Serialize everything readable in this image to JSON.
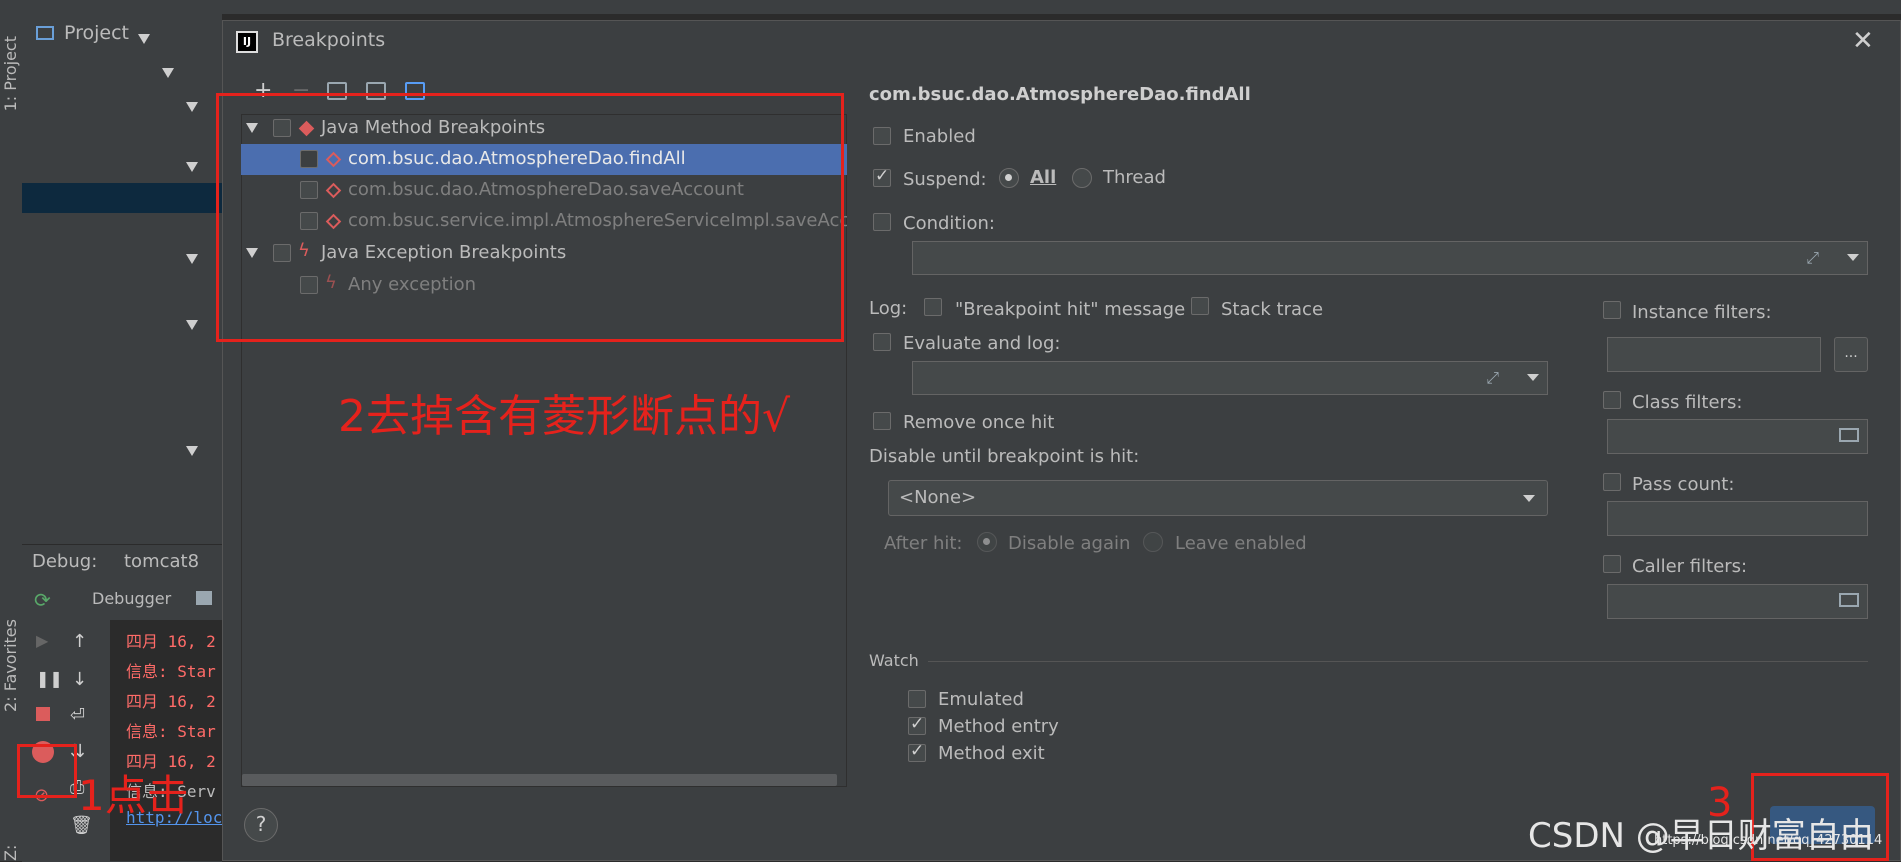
{
  "ide": {
    "project_label": "Project",
    "left_strip_tabs": [
      "1: Project",
      "2: Favorites",
      "Z: Structure"
    ],
    "debug_label": "Debug:",
    "debug_config": "tomcat8",
    "debugger_tab": "Debugger",
    "console_lines": [
      "四月 16, 2",
      "信息: Star",
      "四月 16, 2",
      "信息: Star",
      "四月 16, 2",
      "信息: Serv",
      "http://loc"
    ]
  },
  "dialog": {
    "title": "Breakpoints",
    "close_icon": "close-icon",
    "tree": {
      "groups": [
        {
          "label": "Java Method Breakpoints",
          "checked": false,
          "icon": "red-diamond-icon",
          "items": [
            {
              "label": "com.bsuc.dao.AtmosphereDao.findAll",
              "checked": false,
              "selected": true
            },
            {
              "label": "com.bsuc.dao.AtmosphereDao.saveAccount",
              "checked": false,
              "selected": false
            },
            {
              "label": "com.bsuc.service.impl.AtmosphereServiceImpl.saveAccoun",
              "checked": false,
              "selected": false
            }
          ]
        },
        {
          "label": "Java Exception Breakpoints",
          "checked": false,
          "icon": "lightning-icon",
          "items": [
            {
              "label": "Any exception",
              "checked": false,
              "selected": false
            }
          ]
        }
      ]
    },
    "detail": {
      "heading": "com.bsuc.dao.AtmosphereDao.findAll",
      "enabled_label": "Enabled",
      "suspend_label": "Suspend:",
      "suspend_all": "All",
      "suspend_thread": "Thread",
      "condition_label": "Condition:",
      "log_label": "Log:",
      "log_message_label": "\"Breakpoint hit\" message",
      "stack_trace_label": "Stack trace",
      "evaluate_label": "Evaluate and log:",
      "remove_once_label": "Remove once hit",
      "disable_until_label": "Disable until breakpoint is hit:",
      "disable_until_value": "<None>",
      "after_hit_label": "After hit:",
      "disable_again_label": "Disable again",
      "leave_enabled_label": "Leave enabled",
      "instance_filters_label": "Instance filters:",
      "instance_filters_btn": "...",
      "class_filters_label": "Class filters:",
      "pass_count_label": "Pass count:",
      "caller_filters_label": "Caller filters:",
      "watch_label": "Watch",
      "emulated_label": "Emulated",
      "method_entry_label": "Method entry",
      "method_exit_label": "Method exit",
      "help_label": "?"
    }
  },
  "annotations": {
    "step1": "1点击",
    "step2": "2去掉含有菱形断点的√",
    "step3": "3"
  },
  "watermark": {
    "text": "CSDN @早日财富自由",
    "url": "https://blog.csdn.net/qq_42730114"
  },
  "colors": {
    "annotation_red": "#e5221c",
    "selection_blue": "#4b6eaf",
    "breakpoint_red": "#db5c5c"
  }
}
